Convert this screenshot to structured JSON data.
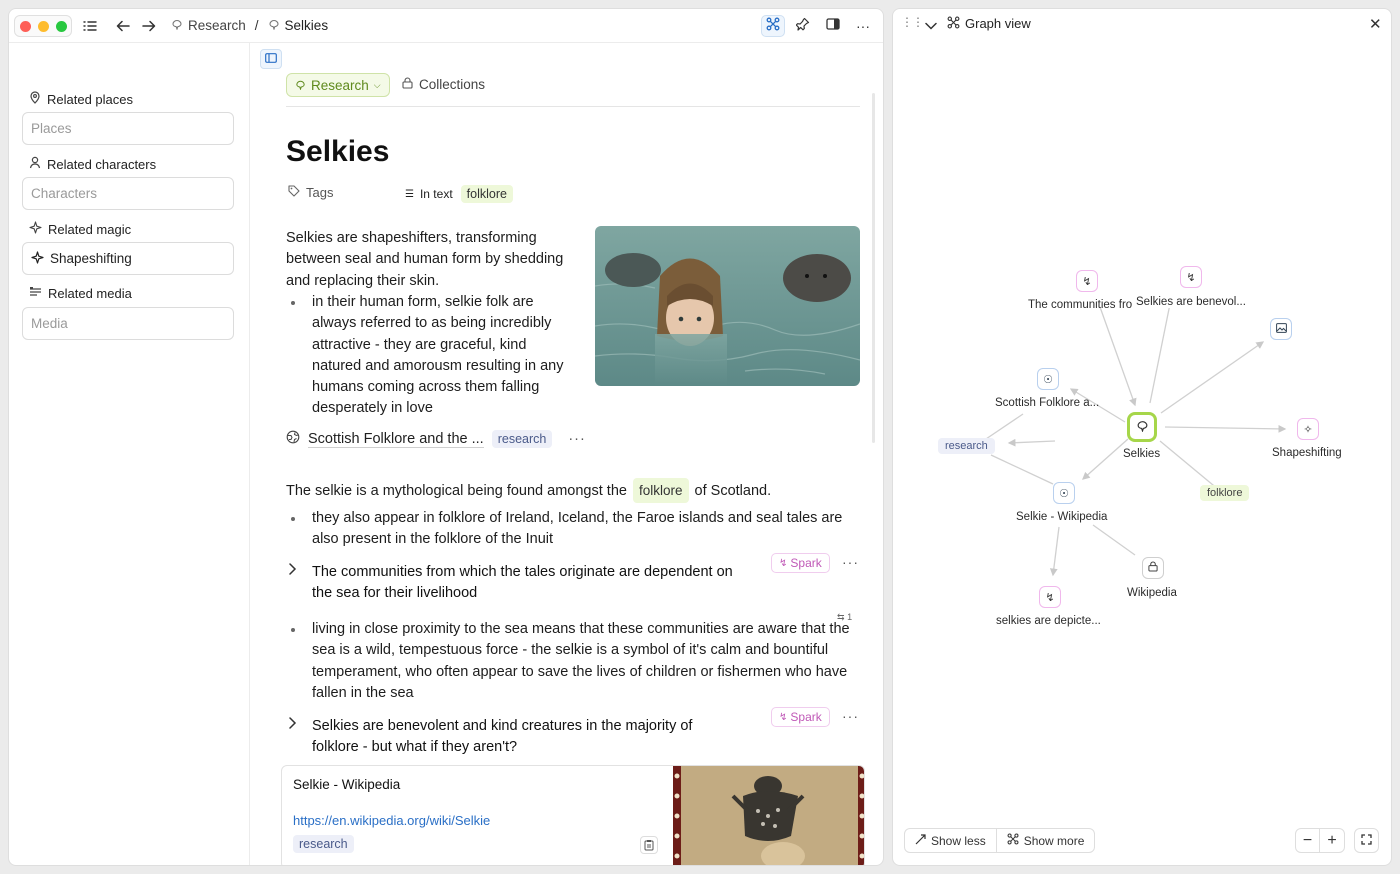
{
  "window": {
    "breadcrumb": {
      "parent": "Research",
      "separator": "/",
      "current": "Selkies"
    }
  },
  "sidebar": {
    "places": {
      "label": "Related places",
      "placeholder": "Places"
    },
    "characters": {
      "label": "Related characters",
      "placeholder": "Characters"
    },
    "magic": {
      "label": "Related magic",
      "value": "Shapeshifting"
    },
    "media": {
      "label": "Related media",
      "placeholder": "Media"
    }
  },
  "doc": {
    "collection_pill": "Research",
    "collections_label": "Collections",
    "title": "Selkies",
    "tags_label": "Tags",
    "in_text_label": "In text",
    "in_text_tag": "folklore",
    "intro": "Selkies are shapeshifters, transforming between seal and human form by shedding and replacing their skin.",
    "bullet1": "in their human form, selkie folk are always referred to as being incredibly attractive - they are graceful, kind natured and amorousm resulting in any humans coming across them falling desperately in love",
    "link_title": "Scottish Folklore and the ...",
    "link_tag": "research",
    "para2_a": "The selkie is a mythological being found amongst the",
    "para2_tag": "folklore",
    "para2_b": "of Scotland.",
    "bullet2": "they also appear in folklore of Ireland, Iceland, the Faroe islands and seal tales are also present in the folklore of the Inuit",
    "toggle1": "The communities from which the tales originate are dependent on the sea for their livelihood",
    "spark_label": "Spark",
    "bullet3": "living in close proximity to the sea means that these communities are aware that the sea is a wild, tempestuous force - the selkie is a symbol of it's calm and bountiful temperament, who often appear to save the lives of children or fishermen who have fallen in the sea",
    "backlink_count": "1",
    "toggle2": "Selkies are benevolent and kind creatures in the majority of folklore - but what if they aren't?",
    "card": {
      "title": "Selkie - Wikipedia",
      "url": "https://en.wikipedia.org/wiki/Selkie",
      "tag": "research"
    }
  },
  "graph": {
    "title": "Graph view",
    "nodes": {
      "communities": "The communities fro",
      "benevolent": "Selkies are benevol...",
      "scottish": "Scottish Folklore a...",
      "selkies": "Selkies",
      "shapeshifting": "Shapeshifting",
      "wikipedia_page": "Selkie - Wikipedia",
      "wikipedia": "Wikipedia",
      "depicted": "selkies are depicte..."
    },
    "tags": {
      "research": "research",
      "folklore": "folklore"
    },
    "show_less": "Show less",
    "show_more": "Show more",
    "zoom_out": "−",
    "zoom_in": "+"
  },
  "colors": {
    "accent_green": "#9ed23c",
    "spark_pink": "#c059b7",
    "link_blue": "#2a6fc6"
  }
}
